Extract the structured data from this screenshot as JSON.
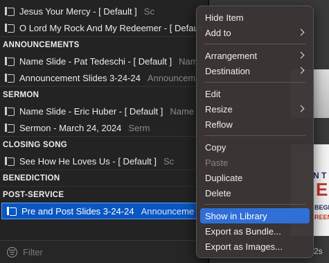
{
  "playlist": {
    "rows": [
      {
        "kind": "item",
        "title": "Jesus Your Mercy - [ Default ]",
        "arrangement": "Sc"
      },
      {
        "kind": "item",
        "title": "O Lord My Rock And My Redeemer - [ Default ]",
        "arrangement": ""
      },
      {
        "kind": "header",
        "title": "ANNOUNCEMENTS"
      },
      {
        "kind": "item",
        "title": "Name Slide - Pat Tedeschi - [ Default ]",
        "arrangement": "Nam"
      },
      {
        "kind": "item",
        "title": "Announcement Slides 3-24-24",
        "arrangement": "Announcem"
      },
      {
        "kind": "header",
        "title": "SERMON"
      },
      {
        "kind": "item",
        "title": "Name Slide - Eric Huber - [ Default ]",
        "arrangement": "Name"
      },
      {
        "kind": "item",
        "title": "Sermon - March 24, 2024",
        "arrangement": "Serm"
      },
      {
        "kind": "header",
        "title": "CLOSING SONG"
      },
      {
        "kind": "item",
        "title": "See How He Loves Us - [ Default ]",
        "arrangement": "Sc"
      },
      {
        "kind": "header",
        "title": "BENEDICTION"
      },
      {
        "kind": "header",
        "title": "POST-SERVICE"
      },
      {
        "kind": "item",
        "title": "Pre and Post Slides 3-24-24",
        "arrangement": "Announceme",
        "selected": true
      }
    ],
    "filter": {
      "placeholder": "Filter"
    }
  },
  "preview": {
    "time_label": "2s",
    "thumb_bottom_letters": [
      "N T",
      "E",
      "BEGI",
      "REEN"
    ]
  },
  "context_menu": {
    "groups": [
      [
        {
          "label": "Hide Item"
        },
        {
          "label": "Add to",
          "submenu": true
        }
      ],
      [
        {
          "label": "Arrangement",
          "submenu": true
        },
        {
          "label": "Destination",
          "submenu": true
        }
      ],
      [
        {
          "label": "Edit"
        },
        {
          "label": "Resize",
          "submenu": true
        },
        {
          "label": "Reflow"
        }
      ],
      [
        {
          "label": "Copy"
        },
        {
          "label": "Paste",
          "disabled": true
        },
        {
          "label": "Duplicate"
        },
        {
          "label": "Delete"
        }
      ],
      [
        {
          "label": "Show in Library",
          "highlighted": true
        },
        {
          "label": "Export as Bundle..."
        },
        {
          "label": "Export as Images..."
        }
      ]
    ]
  },
  "colors": {
    "selection": "#0a56c2",
    "menu_highlight": "#2f6fd6"
  }
}
